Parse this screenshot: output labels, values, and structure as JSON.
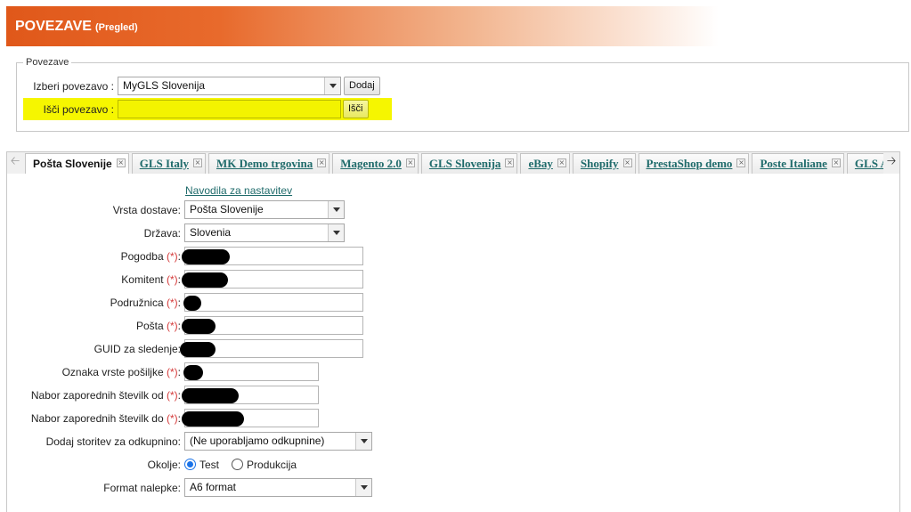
{
  "header": {
    "title": "POVEZAVE",
    "subtitle": "(Pregled)"
  },
  "connections": {
    "legend": "Povezave",
    "select_label": "Izberi povezavo :",
    "select_value": "MyGLS Slovenija",
    "add_button": "Dodaj",
    "search_label": "Išči povezavo :",
    "search_value": "",
    "search_button": "Išči"
  },
  "tabs": [
    {
      "label": "Pošta Slovenije",
      "active": true
    },
    {
      "label": "GLS Italy"
    },
    {
      "label": "MK Demo trgovina"
    },
    {
      "label": "Magento 2.0"
    },
    {
      "label": "GLS Slovenija"
    },
    {
      "label": "eBay"
    },
    {
      "label": "Shopify"
    },
    {
      "label": "PrestaShop demo"
    },
    {
      "label": "Poste Italiane"
    },
    {
      "label": "GLS Avstr"
    }
  ],
  "form": {
    "help_link": "Navodila za nastavitev",
    "req_mark": "(*)",
    "delivery_type": {
      "label": "Vrsta dostave:",
      "value": "Pošta Slovenije"
    },
    "country": {
      "label": "Država:",
      "value": "Slovenia"
    },
    "contract": {
      "label": "Pogodba"
    },
    "client": {
      "label": "Komitent"
    },
    "branch": {
      "label": "Podružnica"
    },
    "post": {
      "label": "Pošta"
    },
    "guid": {
      "label": "GUID za sledenje:"
    },
    "shipment_type": {
      "label": "Oznaka vrste pošiljke"
    },
    "seq_from": {
      "label": "Nabor zaporednih številk od"
    },
    "seq_to": {
      "label": "Nabor zaporednih številk do"
    },
    "cod": {
      "label": "Dodaj storitev za odkupnino:",
      "value": "(Ne uporabljamo odkupnine)"
    },
    "environment": {
      "label": "Okolje:",
      "option_test": "Test",
      "option_prod": "Produkcija",
      "selected": "Test"
    },
    "label_format": {
      "label": "Format nalepke:",
      "value": "A6 format"
    }
  }
}
